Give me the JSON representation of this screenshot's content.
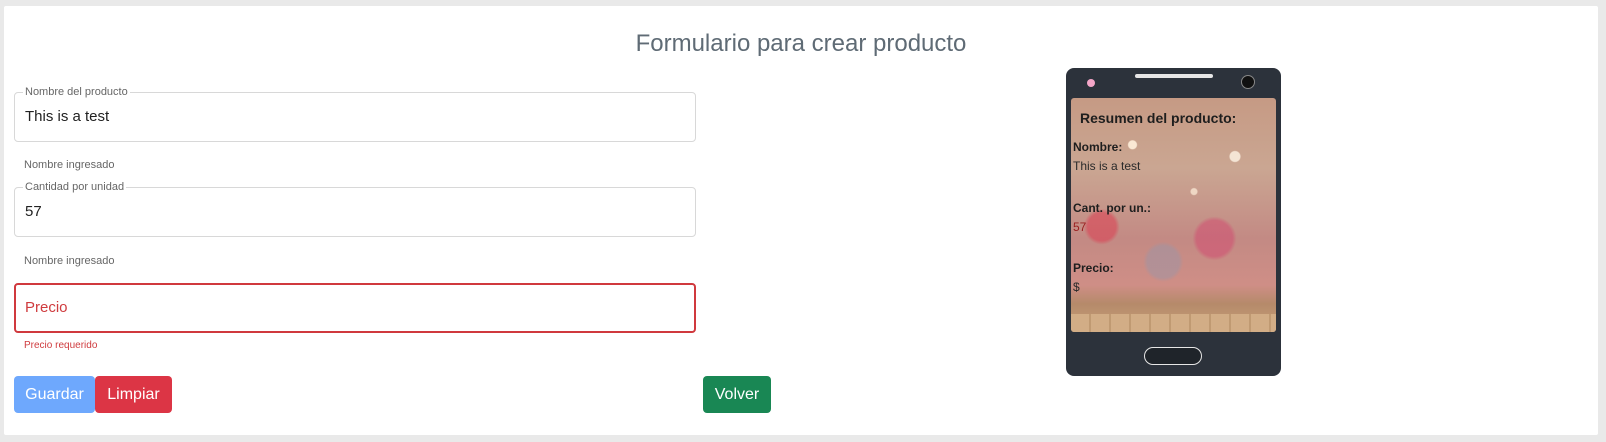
{
  "form": {
    "title": "Formulario para crear producto",
    "name_field": {
      "label": "Nombre del producto",
      "value": "This is a test",
      "helper": "Nombre ingresado"
    },
    "quantity_field": {
      "label": "Cantidad por unidad",
      "value": "57",
      "helper": "Nombre ingresado"
    },
    "price_field": {
      "placeholder": "Precio",
      "error": "Precio requerido",
      "state_color": "#d0393e"
    },
    "buttons": {
      "save": "Guardar",
      "clear": "Limpiar",
      "back": "Volver"
    }
  },
  "preview": {
    "title": "Resumen del producto:",
    "name_label": "Nombre:",
    "name_value": "This is a test",
    "qty_label": "Cant. por un.:",
    "qty_value": "57",
    "price_label": "Precio:",
    "price_value": "$"
  },
  "colors": {
    "save": "#6ea8fd",
    "clear": "#dc3545",
    "back": "#198754",
    "phone": "#2c323b"
  }
}
